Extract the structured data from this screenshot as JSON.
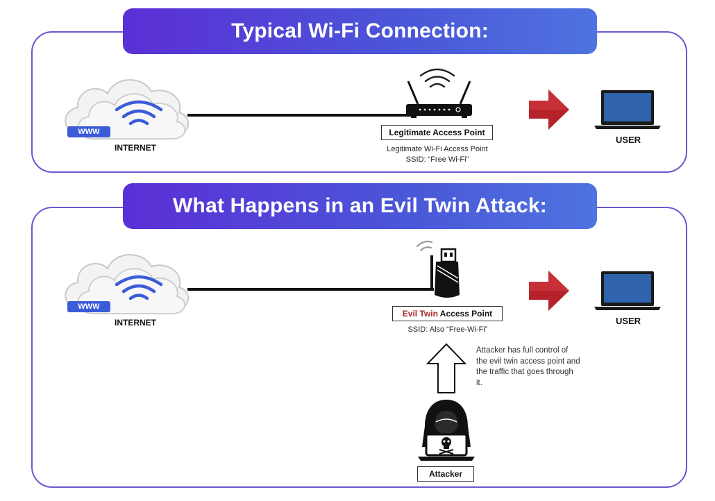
{
  "typical": {
    "title": "Typical Wi-Fi Connection:",
    "internet": {
      "www": "WWW",
      "label": "INTERNET"
    },
    "ap_box": "Legitimate Access Point",
    "ap_line1": "Legitimate Wi-Fi Access Point",
    "ap_line2": "SSID: “Free Wi-Fi”",
    "user": "USER"
  },
  "evil": {
    "title": "What Happens in an Evil Twin Attack:",
    "internet": {
      "www": "WWW",
      "label": "INTERNET"
    },
    "ap_box_red": "Evil Twin",
    "ap_box_rest": " Access Point",
    "ssid": "SSID: Also “Free-Wi-Fi”",
    "note": "Attacker has full control of the evil twin access point and the traffic that goes through it.",
    "attacker": "Attacker",
    "user": "USER"
  },
  "colors": {
    "accent": "#5b2fd6",
    "wifi_blue": "#3b5bd8",
    "arrow_red": "#b5222a",
    "laptop_screen": "#2f63ad"
  },
  "icons": [
    "cloud-icon",
    "wifi-icon",
    "router-icon",
    "usb-adapter-icon",
    "arrow-right-icon",
    "laptop-icon",
    "arrow-up-icon",
    "hacker-icon"
  ]
}
